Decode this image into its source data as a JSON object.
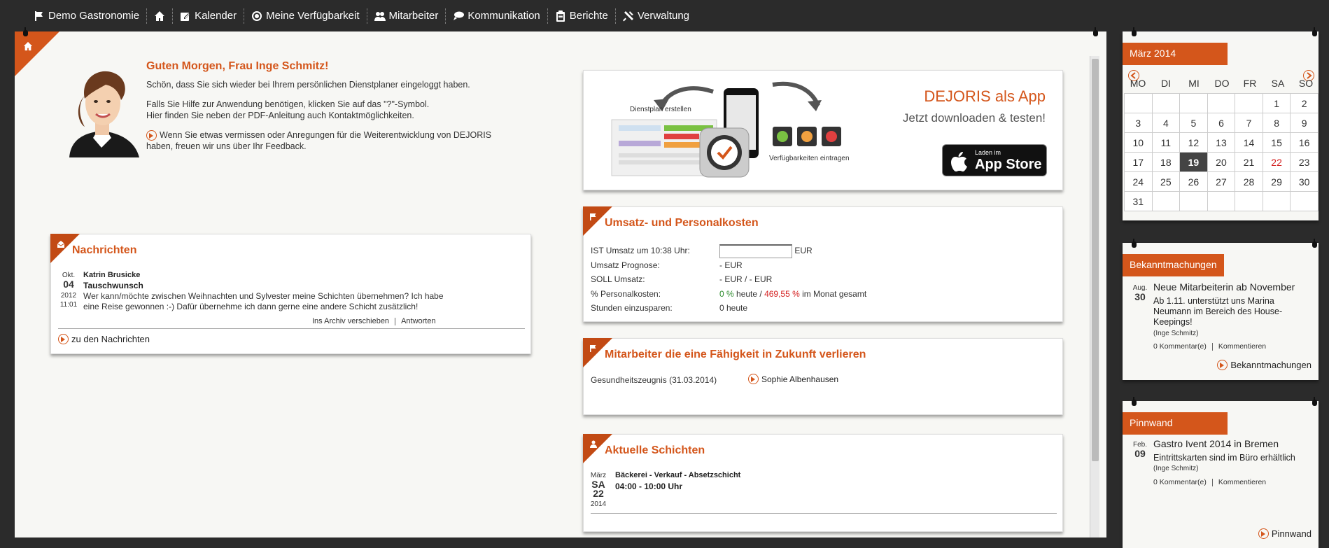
{
  "nav": {
    "items": [
      {
        "label": "Demo Gastronomie",
        "icon": "flag-icon"
      },
      {
        "label": "",
        "icon": "home-icon"
      },
      {
        "label": "Kalender",
        "icon": "edit-icon"
      },
      {
        "label": "Meine Verfügbarkeit",
        "icon": "target-icon"
      },
      {
        "label": "Mitarbeiter",
        "icon": "users-icon"
      },
      {
        "label": "Kommunikation",
        "icon": "chat-icon"
      },
      {
        "label": "Berichte",
        "icon": "clipboard-icon"
      },
      {
        "label": "Verwaltung",
        "icon": "tools-icon"
      }
    ]
  },
  "welcome": {
    "title": "Guten Morgen, Frau Inge Schmitz!",
    "p1": "Schön, dass Sie sich wieder bei Ihrem persönlichen Dienstplaner eingeloggt haben.",
    "p2a": "Falls Sie Hilfe zur Anwendung benötigen, klicken Sie auf das \"?\"-Symbol.",
    "p2b": "Hier finden Sie neben der PDF-Anleitung auch Kontaktmöglichkeiten.",
    "p3a": "Wenn Sie etwas vermissen oder Anregungen für die Weiterentwicklung von DEJORIS",
    "p3b": "haben, freuen wir uns über Ihr Feedback."
  },
  "app_banner": {
    "title": "DEJORIS als App",
    "subtitle": "Jetzt downloaden & testen!",
    "label_plan": "Dienstplan erstellen",
    "label_avail": "Verfügbarkeiten eintragen",
    "store_small": "Laden im",
    "store_big": "App Store"
  },
  "news": {
    "title": "Nachrichten",
    "month": "Okt.",
    "day": "04",
    "year": "2012",
    "time": "11:01",
    "sender": "Katrin Brusicke",
    "subject": "Tauschwunsch",
    "body1": "Wer kann/möchte zwischen Weihnachten und Sylvester meine Schichten übernehmen? Ich habe",
    "body2": "eine Reise gewonnen :-) Dafür übernehme ich dann gerne eine andere Schicht zusätzlich!",
    "archive": "Ins Archiv verschieben",
    "reply": "Antworten",
    "link": "zu den Nachrichten"
  },
  "sales": {
    "title": "Umsatz- und Personalkosten",
    "ist_label": "IST Umsatz um 10:38 Uhr:",
    "ist_value": "",
    "ist_unit": "EUR",
    "prog_label": "Umsatz Prognose:",
    "prog_value": "- EUR",
    "soll_label": "SOLL Umsatz:",
    "soll_value": "- EUR / - EUR",
    "pk_label": "% Personalkosten:",
    "pk_today": "0 %",
    "pk_today_word": "heute /",
    "pk_month": "469,55 %",
    "pk_month_word": "im Monat gesamt",
    "save_label": "Stunden einzusparen:",
    "save_value": "0 heute"
  },
  "skills": {
    "title": "Mitarbeiter die eine Fähigkeit in Zukunft verlieren",
    "skill": "Gesundheitszeugnis (31.03.2014)",
    "person": "Sophie Albenhausen"
  },
  "shifts": {
    "title": "Aktuelle Schichten",
    "month": "März",
    "weekday": "SA",
    "day": "22",
    "year": "2014",
    "name": "Bäckerei - Verkauf - Absetzschicht",
    "time": "04:00 - 10:00 Uhr"
  },
  "calendar": {
    "title": "März 2014",
    "weekdays": [
      "MO",
      "DI",
      "MI",
      "DO",
      "FR",
      "SA",
      "SO"
    ],
    "weeks": [
      [
        "",
        "",
        "",
        "",
        "",
        "1",
        "2"
      ],
      [
        "3",
        "4",
        "5",
        "6",
        "7",
        "8",
        "9"
      ],
      [
        "10",
        "11",
        "12",
        "13",
        "14",
        "15",
        "16"
      ],
      [
        "17",
        "18",
        "19",
        "20",
        "21",
        "22",
        "23"
      ],
      [
        "24",
        "25",
        "26",
        "27",
        "28",
        "29",
        "30"
      ],
      [
        "31",
        "",
        "",
        "",
        "",
        "",
        ""
      ]
    ],
    "today": "19",
    "holiday": "22"
  },
  "announcements": {
    "title": "Bekanntmachungen",
    "month": "Aug.",
    "day": "30",
    "headline": "Neue Mitarbeiterin ab November",
    "text": "Ab 1.11. unterstützt uns Marina Neumann im Bereich des House-Keepings!",
    "author": "(Inge Schmitz)",
    "comments": "0 Kommentar(e)",
    "comment_link": "Kommentieren",
    "link": "Bekanntmachungen"
  },
  "pinboard": {
    "title": "Pinnwand",
    "month": "Feb.",
    "day": "09",
    "headline": "Gastro Ivent 2014 in Bremen",
    "text": "Eintrittskarten sind im Büro erhältlich",
    "author": "(Inge Schmitz)",
    "comments": "0 Kommentar(e)",
    "comment_link": "Kommentieren",
    "link": "Pinnwand"
  },
  "colors": {
    "accent": "#d4561b",
    "dark": "#2b2b2b",
    "positive": "#2e8b2e",
    "negative": "#d42020"
  }
}
